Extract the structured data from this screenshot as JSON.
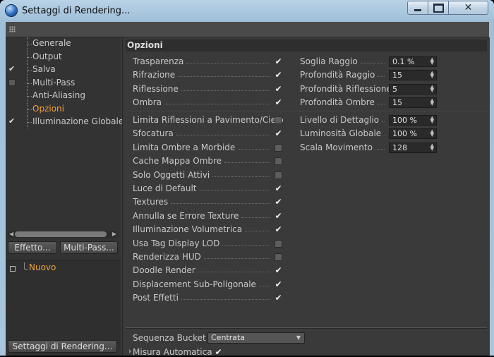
{
  "window": {
    "title": "Settaggi di Rendering...",
    "close_glyph": "✕"
  },
  "icons": {
    "app": "cinema4d-sphere-icon",
    "check": "✔"
  },
  "tree": [
    {
      "label": "Generale",
      "check": "none"
    },
    {
      "label": "Output",
      "check": "none"
    },
    {
      "label": "Salva",
      "check": "on"
    },
    {
      "label": "Multi-Pass",
      "check": "off"
    },
    {
      "label": "Anti-Aliasing",
      "check": "none"
    },
    {
      "label": "Opzioni",
      "check": "none",
      "active": true
    },
    {
      "label": "Illuminazione Globale",
      "check": "on"
    }
  ],
  "buttons": {
    "effetto": "Effetto...",
    "multipass": "Multi-Pass...",
    "settaggi": "Settaggi di Rendering..."
  },
  "lower_tree": {
    "nuovo": "Nuovo"
  },
  "section": {
    "title": "Opzioni"
  },
  "options_a": [
    {
      "label": "Trasparenza",
      "checked": true
    },
    {
      "label": "Rifrazione",
      "checked": true
    },
    {
      "label": "Riflessione",
      "checked": true
    },
    {
      "label": "Ombra",
      "checked": true
    }
  ],
  "fields_a": [
    {
      "label": "Soglia Raggio",
      "value": "0.1 %"
    },
    {
      "label": "Profondità Raggio",
      "value": "15"
    },
    {
      "label": "Profondità Riflessione",
      "value": "5"
    },
    {
      "label": "Profondità Ombre",
      "value": "15"
    }
  ],
  "options_b": [
    {
      "label": "Limita Riflessioni a Pavimento/Cielo",
      "checked": false
    },
    {
      "label": "Sfocatura",
      "checked": true
    },
    {
      "label": "Limita Ombre a Morbide",
      "checked": false
    },
    {
      "label": "Cache Mappa Ombre",
      "checked": false
    },
    {
      "label": "Solo Oggetti Attivi",
      "checked": false
    },
    {
      "label": "Luce di Default",
      "checked": true
    },
    {
      "label": "Textures",
      "checked": true
    },
    {
      "label": "Annulla se Errore Texture",
      "checked": true
    },
    {
      "label": "Illuminazione Volumetrica",
      "checked": true
    },
    {
      "label": "Usa Tag Display LOD",
      "checked": false
    },
    {
      "label": "Renderizza HUD",
      "checked": false
    },
    {
      "label": "Doodle Render",
      "checked": true
    },
    {
      "label": "Displacement Sub-Poligonale",
      "checked": true
    },
    {
      "label": "Post Effetti",
      "checked": true
    }
  ],
  "fields_b": [
    {
      "label": "Livello di Dettaglio",
      "value": "100 %"
    },
    {
      "label": "Luminosità Globale",
      "value": "100 %"
    },
    {
      "label": "Scala Movimento",
      "value": "128"
    }
  ],
  "bucket": {
    "label": "Sequenza Bucket",
    "value": "Centrata"
  },
  "misura": {
    "label": "Misura Automatica",
    "checked": true
  }
}
